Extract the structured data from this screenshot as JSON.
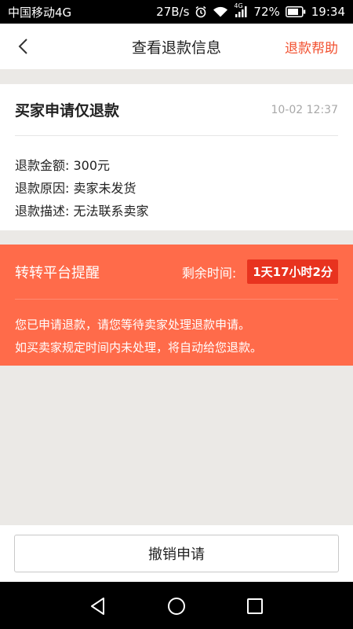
{
  "status_bar": {
    "carrier": "中国移动4G",
    "net_speed": "27B/s",
    "signal_tag": "4G",
    "battery": "72%",
    "time": "19:34"
  },
  "header": {
    "title": "查看退款信息",
    "help_link": "退款帮助"
  },
  "refund": {
    "title": "买家申请仅退款",
    "time": "10-02 12:37",
    "details": [
      "退款金额: 300元",
      "退款原因: 卖家未发货",
      "退款描述: 无法联系卖家"
    ]
  },
  "reminder": {
    "title": "转转平台提醒",
    "remain_label": "剩余时间:",
    "remain_value": "1天17小时2分",
    "lines": [
      "您已申请退款，请您等待卖家处理退款申请。",
      "如买卖家规定时间内未处理，将自动给您退款。"
    ]
  },
  "actions": {
    "cancel_label": "撤销申请"
  },
  "colors": {
    "accent": "#f2502f",
    "reminder_bg": "#ff6b4a",
    "badge_bg": "#e8331f",
    "page_bg": "#ebe9e6"
  }
}
